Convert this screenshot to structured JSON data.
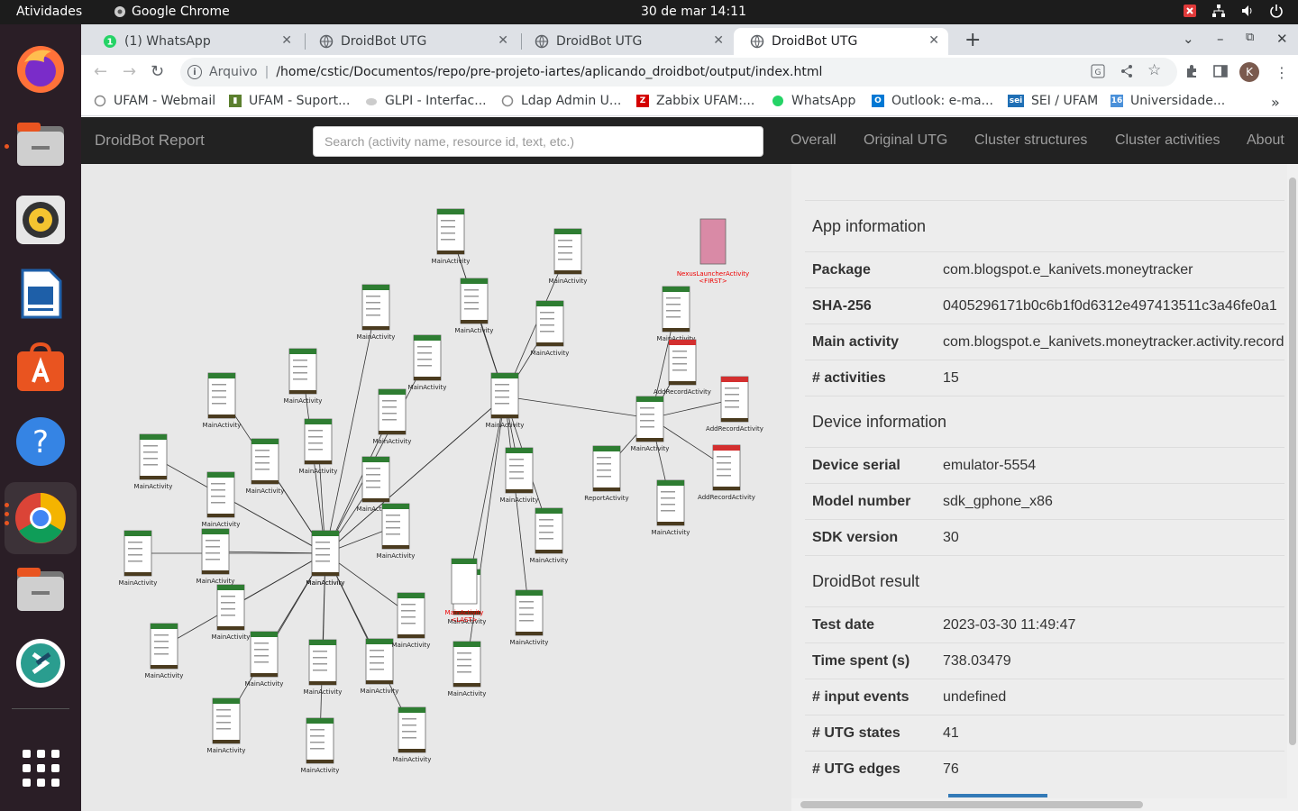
{
  "system": {
    "activities": "Atividades",
    "app_name": "Google Chrome",
    "clock": "30 de mar  14:11"
  },
  "dock": {
    "apps": [
      "Firefox",
      "Files",
      "Rhythmbox",
      "LibreOffice Writer",
      "Ubuntu Software",
      "Help",
      "Google Chrome",
      "Files",
      "Remote Desktop",
      "Show Applications"
    ]
  },
  "tabs": [
    {
      "title": "(1) WhatsApp",
      "favicon": "whatsapp-icon"
    },
    {
      "title": "DroidBot UTG",
      "favicon": "globe-icon"
    },
    {
      "title": "DroidBot UTG",
      "favicon": "globe-icon"
    },
    {
      "title": "DroidBot UTG",
      "favicon": "globe-icon"
    }
  ],
  "address": {
    "scheme": "Arquivo",
    "url": "/home/cstic/Documentos/repo/pre-projeto-iartes/aplicando_droidbot/output/index.html"
  },
  "profile_initial": "K",
  "bookmarks": [
    {
      "label": "UFAM - Webmail",
      "color": "#888888"
    },
    {
      "label": "UFAM - Suport...",
      "color": "#5b7f2e"
    },
    {
      "label": "GLPI - Interfac...",
      "color": "#bbbbbb"
    },
    {
      "label": "Ldap Admin U...",
      "color": "#888888"
    },
    {
      "label": "Zabbix UFAM:...",
      "color": "#d40000"
    },
    {
      "label": "WhatsApp",
      "color": "#25d366"
    },
    {
      "label": "Outlook: e-ma...",
      "color": "#0078d4"
    },
    {
      "label": "SEI / UFAM",
      "color": "#1f6fb5"
    },
    {
      "label": "Universidade...",
      "color": "#4a90d9"
    }
  ],
  "navbar": {
    "brand": "DroidBot Report",
    "search_placeholder": "Search (activity name, resource id, text, etc.)",
    "links": [
      "Overall",
      "Original UTG",
      "Cluster structures",
      "Cluster activities",
      "About"
    ]
  },
  "graph": {
    "node_label": "MainActivity",
    "first_label": "NexusLauncherActivity",
    "first_tag": "<FIRST>",
    "last_label": "MainActivity",
    "last_tag": "<LAST>",
    "other_labels": [
      "AddRecordActivity",
      "ReportActivity"
    ]
  },
  "info": {
    "app_title": "App information",
    "app_rows": [
      {
        "k": "Package",
        "v": "com.blogspot.e_kanivets.moneytracker"
      },
      {
        "k": "SHA-256",
        "v": "0405296171b0c6b1f0d6312e497413511c3a46fe0a1"
      },
      {
        "k": "Main activity",
        "v": "com.blogspot.e_kanivets.moneytracker.activity.record"
      },
      {
        "k": "# activities",
        "v": "15"
      }
    ],
    "device_title": "Device information",
    "device_rows": [
      {
        "k": "Device serial",
        "v": "emulator-5554"
      },
      {
        "k": "Model number",
        "v": "sdk_gphone_x86"
      },
      {
        "k": "SDK version",
        "v": "30"
      }
    ],
    "result_title": "DroidBot result",
    "result_rows": [
      {
        "k": "Test date",
        "v": "2023-03-30 11:49:47"
      },
      {
        "k": "Time spent (s)",
        "v": "738.03479"
      },
      {
        "k": "# input events",
        "v": "undefined"
      },
      {
        "k": "# UTG states",
        "v": "41"
      },
      {
        "k": "# UTG edges",
        "v": "76"
      }
    ]
  }
}
